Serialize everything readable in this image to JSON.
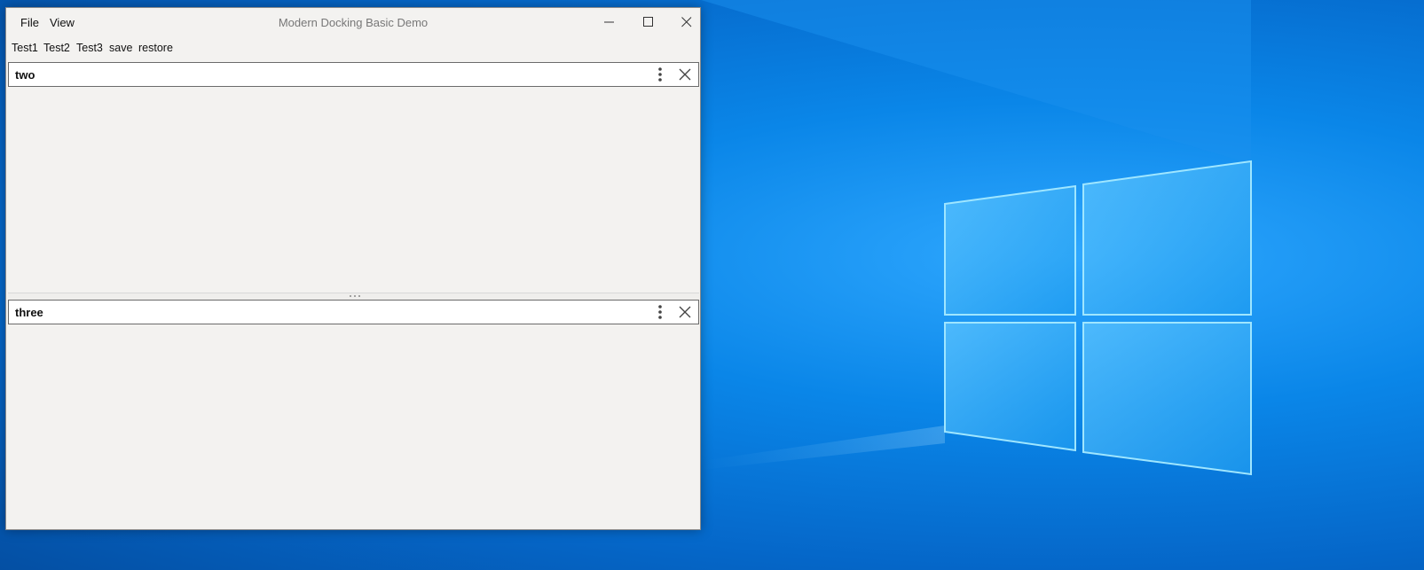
{
  "window": {
    "title": "Modern Docking Basic Demo"
  },
  "menu": {
    "file": "File",
    "view": "View"
  },
  "toolbar": {
    "buttons": [
      "Test1",
      "Test2",
      "Test3",
      "save",
      "restore"
    ]
  },
  "panels": [
    {
      "title": "two"
    },
    {
      "title": "three"
    }
  ],
  "icons": {
    "minimize": "minimize-icon",
    "maximize": "maximize-icon",
    "close": "close-icon",
    "panel_menu": "vertical-ellipsis-icon",
    "panel_close": "close-icon",
    "splitter": "grip-dots-icon"
  },
  "colors": {
    "desktop_accent": "#0a86e8",
    "window_bg": "#f3f2f0",
    "header_bg": "#ffffff"
  }
}
